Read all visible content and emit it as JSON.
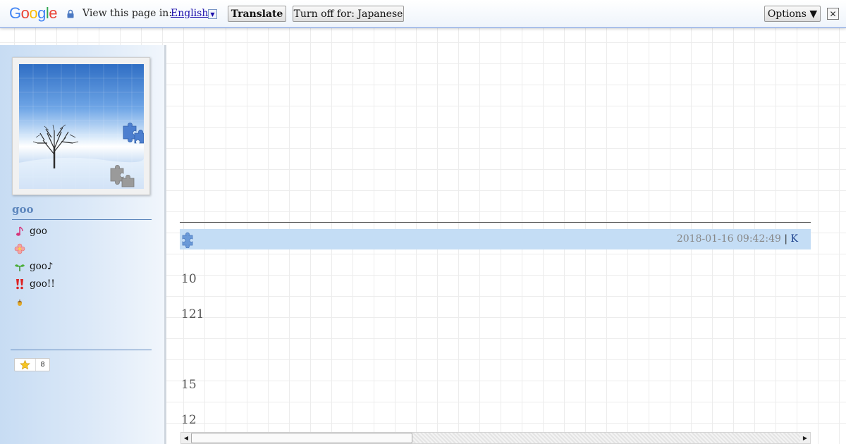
{
  "translate_bar": {
    "logo": "Google",
    "view_label": "View this page in:",
    "language": "English",
    "translate_label": "Translate",
    "turn_off_label": "Turn off for: Japanese",
    "options_label": "Options ▼",
    "close_label": "✕"
  },
  "sidebar": {
    "blog_name": "goo",
    "items": [
      {
        "icon": "music-note-icon",
        "label": "goo"
      },
      {
        "icon": "flower-icon",
        "label": ""
      },
      {
        "icon": "sprout-icon",
        "label": "goo♪"
      },
      {
        "icon": "exclamation-icon",
        "label": "goo!!"
      },
      {
        "icon": "acorn-icon",
        "label": ""
      }
    ],
    "star_count": "8"
  },
  "entry": {
    "timestamp": "2018-01-16 09:42:49",
    "separator": "|",
    "link_label": "K",
    "lines": [
      "10",
      "121",
      "15",
      "12"
    ]
  },
  "colors": {
    "header_bg": "#c4ddf5",
    "sidebar_accent": "#5e87bd",
    "link": "#1a0dab"
  }
}
